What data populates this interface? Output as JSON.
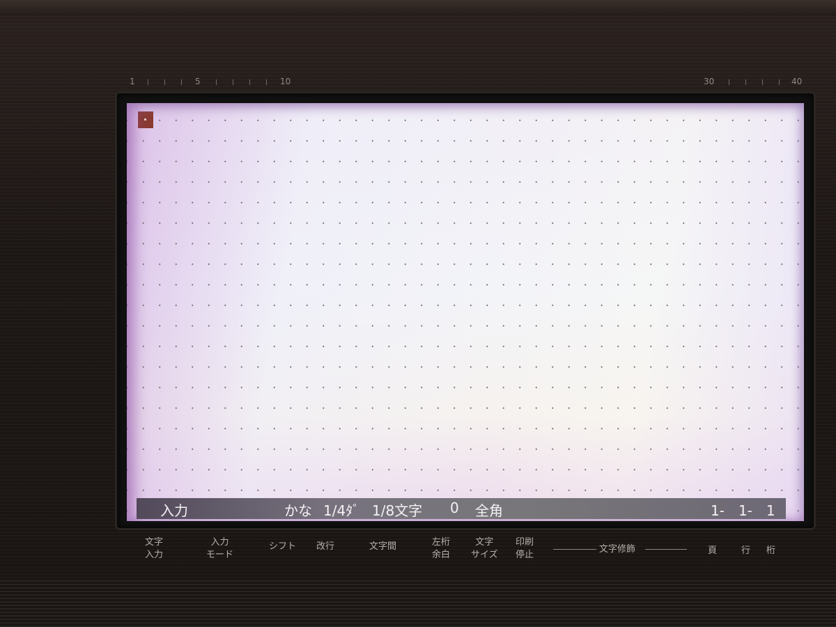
{
  "ruler": {
    "labels": [
      "1",
      "5",
      "10",
      "30",
      "40"
    ]
  },
  "status_bar": {
    "mode": "入力",
    "kana": "かな",
    "pitch": "1/4ﾀﾞ",
    "chars": "1/8文字",
    "count": "0",
    "width": "全角",
    "position": "1-　1-　1"
  },
  "keys": {
    "char_input": "文字\n入力",
    "input_mode": "入力\nモード",
    "shift": "シフト",
    "newline": "改行",
    "char_spacing": "文字間",
    "left_margin": "左桁\n余白",
    "char_size": "文字\nサイズ",
    "print_stop": "印刷\n停止",
    "char_decoration": "文字修飾",
    "page": "頁",
    "line": "行",
    "column": "桁"
  }
}
